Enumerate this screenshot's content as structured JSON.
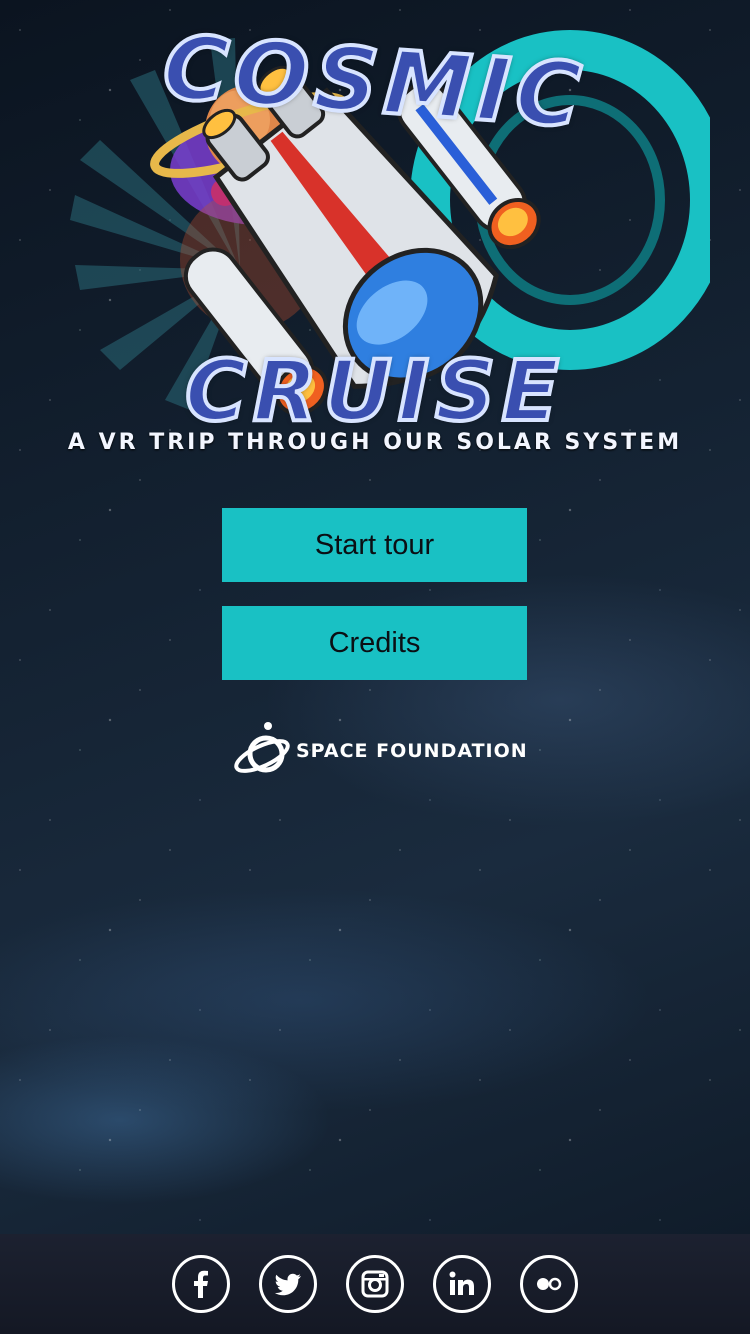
{
  "logo": {
    "word_top": "COSMIC",
    "word_bottom": "CRUISE",
    "tagline": "A VR TRIP THROUGH OUR SOLAR SYSTEM"
  },
  "menu": {
    "start_label": "Start tour",
    "credits_label": "Credits"
  },
  "sponsor": {
    "name": "SPACE FOUNDATION",
    "icon": "space-foundation-logo-icon"
  },
  "footer": {
    "social": [
      {
        "name": "facebook",
        "icon": "facebook-icon"
      },
      {
        "name": "twitter",
        "icon": "twitter-icon"
      },
      {
        "name": "instagram",
        "icon": "instagram-icon"
      },
      {
        "name": "linkedin",
        "icon": "linkedin-icon"
      },
      {
        "name": "flickr",
        "icon": "flickr-icon"
      }
    ]
  },
  "colors": {
    "button": "#19c1c4",
    "button_text": "#0b0f14",
    "footer_bg": "#1c2130",
    "logo_ring": "#19c1c4",
    "logo_text": "#3a4fb0"
  }
}
